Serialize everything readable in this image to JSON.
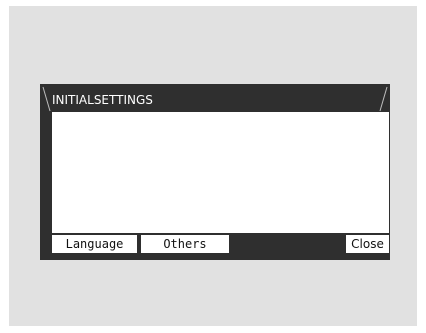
{
  "dialog": {
    "title": "INITIALSETTINGS"
  },
  "buttons": {
    "language": "Language",
    "others": "Others",
    "close": "Close"
  },
  "colors": {
    "bezel": "#e1e1e1",
    "panel": "#2f2f2f",
    "content": "#ffffff",
    "text_on_panel": "#ffffff",
    "button_text": "#111111"
  }
}
